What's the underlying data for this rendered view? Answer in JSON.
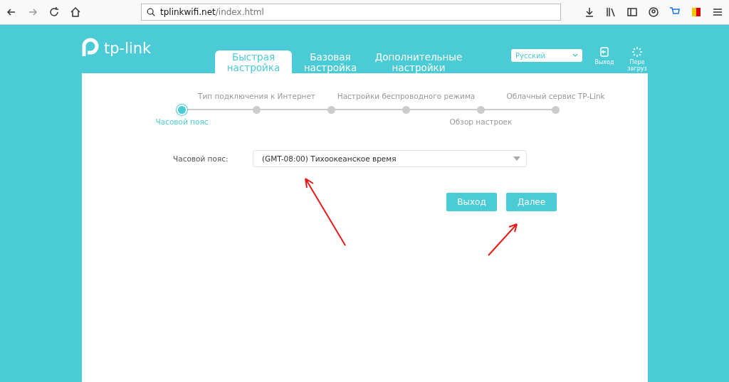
{
  "browser": {
    "url_host": "tplinkwifi.net",
    "url_path": "/index.html"
  },
  "header": {
    "logo": "tp-link",
    "tabs": [
      {
        "label": "Быстрая настройка",
        "selected": true
      },
      {
        "label": "Базовая настройка",
        "selected": false
      },
      {
        "label": "Дополнительные настройки",
        "selected": false
      }
    ],
    "language": "Русский",
    "actions": [
      {
        "kind": "exit",
        "label": "Выход"
      },
      {
        "kind": "reboot",
        "label": "Пере загруз"
      }
    ]
  },
  "steps": [
    {
      "kind": "below",
      "label": "Часовой пояс",
      "selected": true
    },
    {
      "kind": "above",
      "label": "Тип подключения к Интернет",
      "selected": false
    },
    {
      "selected": false
    },
    {
      "kind": "above",
      "label": "Настройки беспроводного режима",
      "selected": false
    },
    {
      "kind": "below",
      "label": "Обзор настроек",
      "selected": false
    },
    {
      "kind": "above",
      "label": "Облачный сервис TP-Link",
      "selected": false
    }
  ],
  "form": {
    "label": "Часовой пояс:",
    "value": "(GMT-08:00) Тихоокеанское время"
  },
  "buttons": [
    "Выход",
    "Далее"
  ]
}
